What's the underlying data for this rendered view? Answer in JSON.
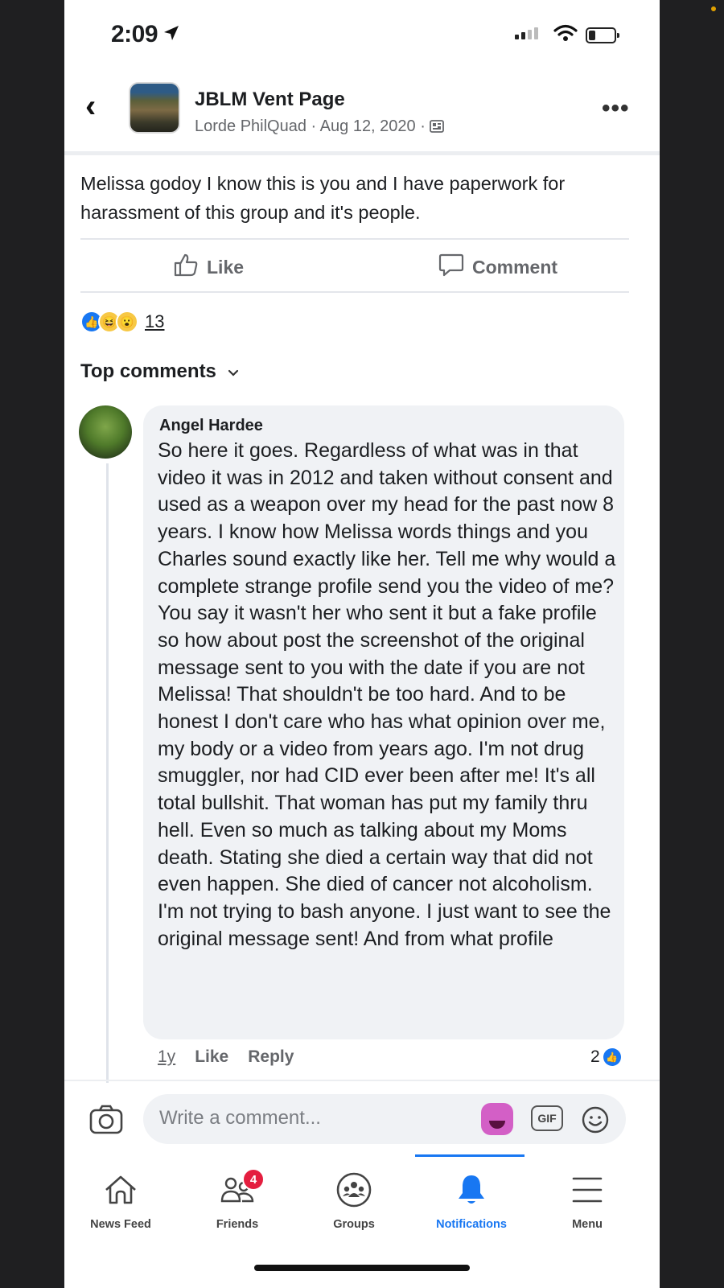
{
  "status_bar": {
    "time": "2:09"
  },
  "header": {
    "group_name": "JBLM Vent Page",
    "author": "Lorde PhilQuad",
    "date": "Aug 12, 2020"
  },
  "post": {
    "text": "Melissa godoy I know this is you and I have paperwork for harassment of this group and it's people.",
    "like_label": "Like",
    "comment_label": "Comment",
    "reaction_count": "13"
  },
  "comments_section": {
    "sort_label": "Top comments"
  },
  "comment": {
    "author": "Angel Hardee",
    "text": "So here it goes. Regardless of what was in that video it was in 2012 and taken without consent and used as a weapon over my head for the past now 8 years. I know how Melissa words things and you Charles sound exactly like her. Tell me why would a complete strange profile send you the video of me? You say it wasn't her who sent it but a fake profile so how about post the screenshot of the original message sent to you with the date if you are not Melissa! That shouldn't be too hard. And to be honest I don't care who has what opinion over me, my body or a video from years ago. I'm not drug smuggler, nor had CID ever been after me! It's all total bullshit. That woman has put my family thru hell. Even so much as talking about my Moms death. Stating she died a certain way that did not even happen. She died of cancer not alcoholism. I'm not trying to bash anyone. I just want to see the original message sent! And from what profile",
    "time": "1y",
    "like_label": "Like",
    "reply_label": "Reply",
    "reaction_count": "2"
  },
  "composer": {
    "placeholder": "Write a comment...",
    "gif_label": "GIF"
  },
  "nav": {
    "items": [
      {
        "label": "News Feed",
        "icon": "home-icon"
      },
      {
        "label": "Friends",
        "icon": "friends-icon",
        "badge": "4"
      },
      {
        "label": "Groups",
        "icon": "groups-icon"
      },
      {
        "label": "Notifications",
        "icon": "bell-icon",
        "active": true
      },
      {
        "label": "Menu",
        "icon": "menu-icon"
      }
    ]
  },
  "colors": {
    "accent": "#1877f2",
    "badge": "#e41e3f",
    "bubble": "#f0f2f5",
    "secondary_text": "#65676b"
  }
}
